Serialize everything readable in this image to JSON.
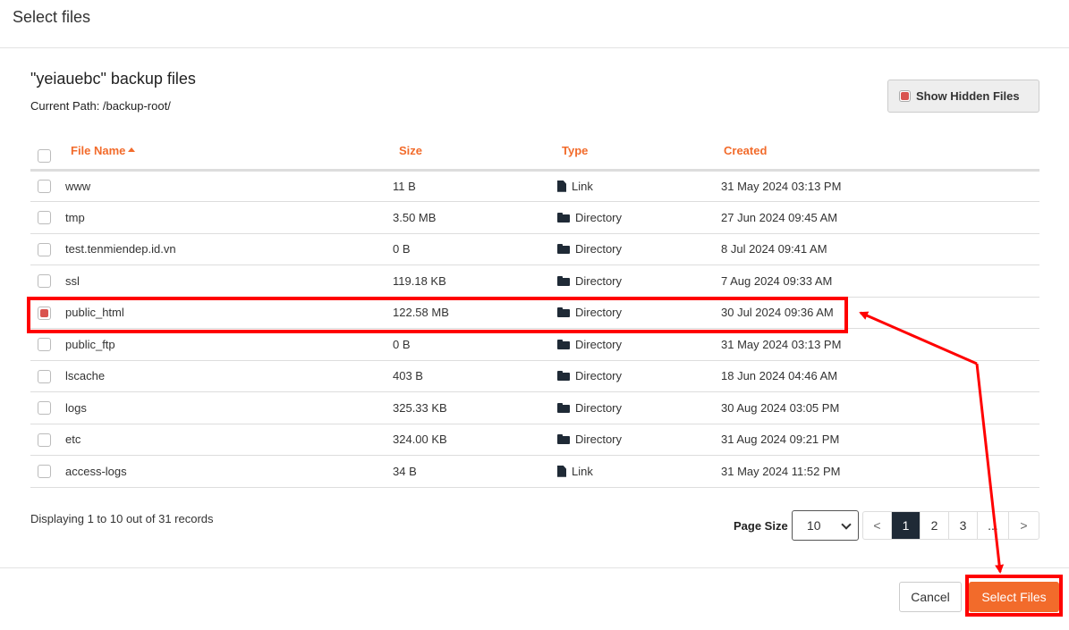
{
  "modal": {
    "title": "Select files"
  },
  "section": {
    "title": "\"yeiauebc\" backup files",
    "current_path": "Current Path: /backup-root/"
  },
  "toolbar": {
    "show_hidden_label": "Show Hidden Files",
    "show_hidden_checked": true
  },
  "table": {
    "columns": {
      "name": "File Name",
      "size": "Size",
      "type": "Type",
      "created": "Created"
    },
    "sort": {
      "column": "File Name",
      "direction": "ascending"
    },
    "rows": [
      {
        "name": "www",
        "size": "11 B",
        "type": "Link",
        "icon": "file-icon",
        "created": "31 May 2024 03:13 PM",
        "checked": false
      },
      {
        "name": "tmp",
        "size": "3.50 MB",
        "type": "Directory",
        "icon": "folder-icon",
        "created": "27 Jun 2024 09:45 AM",
        "checked": false
      },
      {
        "name": "test.tenmiendep.id.vn",
        "size": "0 B",
        "type": "Directory",
        "icon": "folder-icon",
        "created": "8 Jul 2024 09:41 AM",
        "checked": false
      },
      {
        "name": "ssl",
        "size": "119.18 KB",
        "type": "Directory",
        "icon": "folder-icon",
        "created": "7 Aug 2024 09:33 AM",
        "checked": false
      },
      {
        "name": "public_html",
        "size": "122.58 MB",
        "type": "Directory",
        "icon": "folder-icon",
        "created": "30 Jul 2024 09:36 AM",
        "checked": true
      },
      {
        "name": "public_ftp",
        "size": "0 B",
        "type": "Directory",
        "icon": "folder-icon",
        "created": "31 May 2024 03:13 PM",
        "checked": false
      },
      {
        "name": "lscache",
        "size": "403 B",
        "type": "Directory",
        "icon": "folder-icon",
        "created": "18 Jun 2024 04:46 AM",
        "checked": false
      },
      {
        "name": "logs",
        "size": "325.33 KB",
        "type": "Directory",
        "icon": "folder-icon",
        "created": "30 Aug 2024 03:05 PM",
        "checked": false
      },
      {
        "name": "etc",
        "size": "324.00 KB",
        "type": "Directory",
        "icon": "folder-icon",
        "created": "31 Aug 2024 09:21 PM",
        "checked": false
      },
      {
        "name": "access-logs",
        "size": "34 B",
        "type": "Link",
        "icon": "file-icon",
        "created": "31 May 2024 11:52 PM",
        "checked": false
      }
    ]
  },
  "footer": {
    "records_info": "Displaying 1 to 10 out of 31 records",
    "page_size_label": "Page Size",
    "page_size_value": "10",
    "pagination": {
      "prev": "<",
      "pages": [
        "1",
        "2",
        "3"
      ],
      "current": "1",
      "ellipsis": "...",
      "next": ">"
    }
  },
  "actions": {
    "cancel_label": "Cancel",
    "select_label": "Select Files"
  },
  "colors": {
    "accent": "#f26b2b",
    "checked": "#d9534f",
    "active_page": "#1f2a36",
    "annotation": "#ff0000"
  }
}
